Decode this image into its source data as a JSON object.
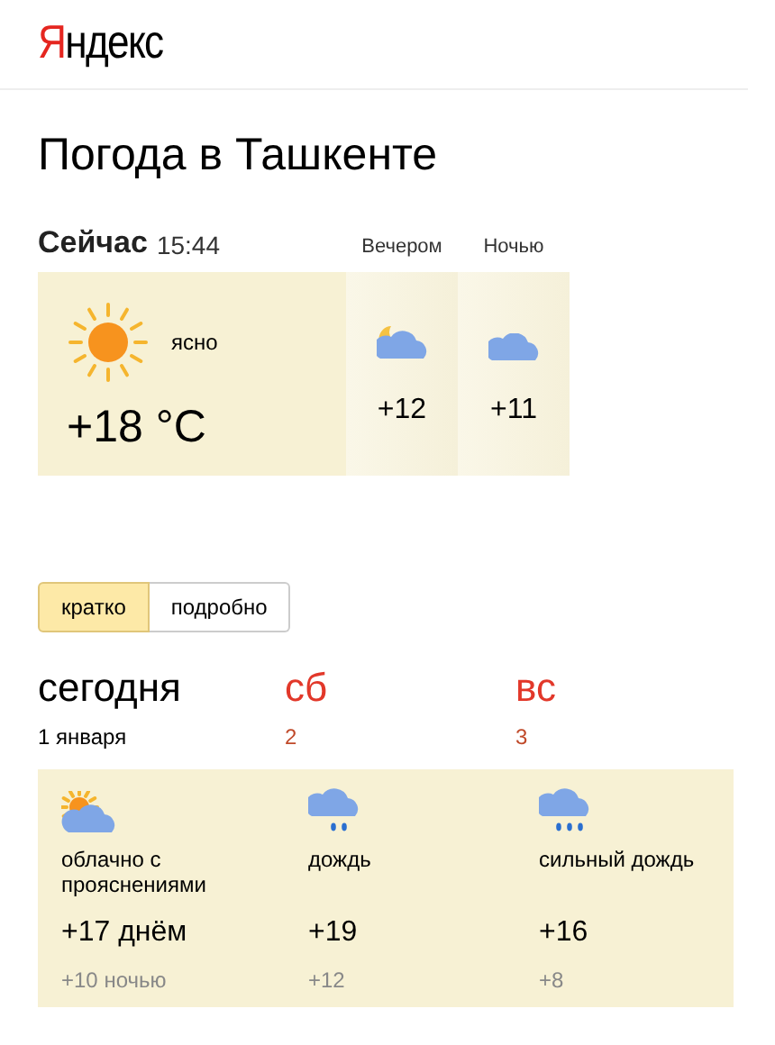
{
  "logo": {
    "initial": "Я",
    "rest": "ндекс"
  },
  "title": "Погода в Ташкенте",
  "now": {
    "label": "Сейчас",
    "time": "15:44",
    "kind": "sun",
    "condition": "ясно",
    "temperature": "+18 °C"
  },
  "later": [
    {
      "label": "Вечером",
      "kind": "moon-cloud",
      "temperature": "+12"
    },
    {
      "label": "Ночью",
      "kind": "cloud",
      "temperature": "+11"
    }
  ],
  "view_tabs": [
    {
      "label": "кратко",
      "selected": true
    },
    {
      "label": "подробно",
      "selected": false
    }
  ],
  "days": [
    {
      "name": "сегодня",
      "date": "1 января",
      "weekend": false,
      "kind": "sun-cloud",
      "condition": "облачно с прояснениями",
      "day_temp": "+17 днём",
      "night_temp": "+10 ночью"
    },
    {
      "name": "сб",
      "date": "2",
      "weekend": true,
      "kind": "rain",
      "condition": "дождь",
      "day_temp": "+19",
      "night_temp": "+12"
    },
    {
      "name": "вс",
      "date": "3",
      "weekend": true,
      "kind": "heavy-rain",
      "condition": "сильный дождь",
      "day_temp": "+16",
      "night_temp": "+8"
    }
  ]
}
